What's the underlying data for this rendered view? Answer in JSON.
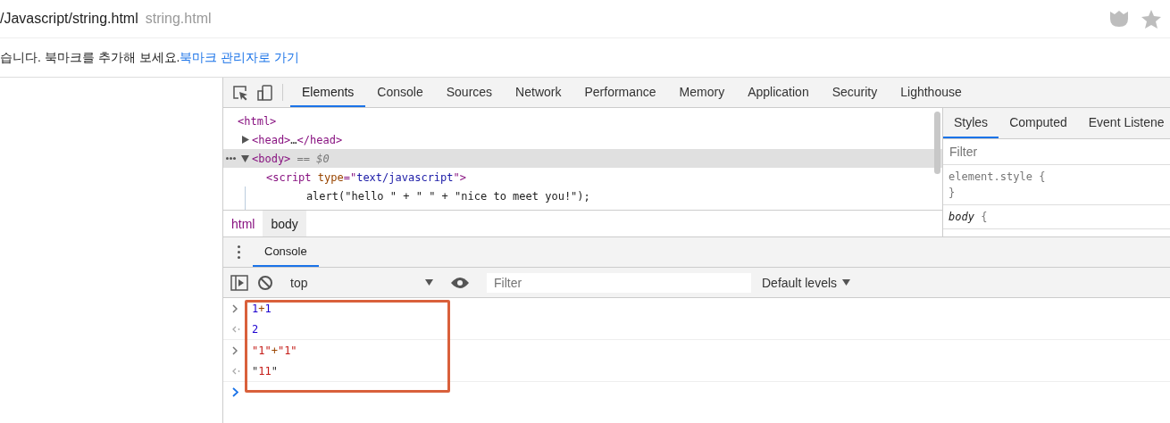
{
  "address_bar": {
    "url": "/Javascript/string.html",
    "title": "string.html"
  },
  "bookmark_bar": {
    "message": "습니다. 북마크를 추가해 보세요.",
    "link": "북마크 관리자로 가기"
  },
  "devtools": {
    "tabs": [
      {
        "label": "Elements",
        "selected": true
      },
      {
        "label": "Console",
        "selected": false
      },
      {
        "label": "Sources",
        "selected": false
      },
      {
        "label": "Network",
        "selected": false
      },
      {
        "label": "Performance",
        "selected": false
      },
      {
        "label": "Memory",
        "selected": false
      },
      {
        "label": "Application",
        "selected": false
      },
      {
        "label": "Security",
        "selected": false
      },
      {
        "label": "Lighthouse",
        "selected": false
      }
    ],
    "dom_tree": [
      {
        "selected": false,
        "tokens": [
          {
            "kind": "tag",
            "text": "<html>"
          }
        ],
        "children": [
          {
            "expanded": false,
            "selected": false,
            "tokens": [
              {
                "kind": "tag",
                "text": "<head>"
              },
              {
                "kind": "text",
                "text": "…"
              },
              {
                "kind": "tag",
                "text": "</head>"
              }
            ]
          },
          {
            "expanded": true,
            "selected": true,
            "tokens": [
              {
                "kind": "tag",
                "text": "<body>"
              },
              {
                "kind": "marker",
                "text": " == $0"
              }
            ],
            "children": [
              {
                "selected": false,
                "tokens": [
                  {
                    "kind": "tag",
                    "text": "<script "
                  },
                  {
                    "kind": "attr",
                    "text": "type"
                  },
                  {
                    "kind": "tag",
                    "text": "=\""
                  },
                  {
                    "kind": "value",
                    "text": "text/javascript"
                  },
                  {
                    "kind": "tag",
                    "text": "\">"
                  }
                ],
                "children": [
                  {
                    "selected": false,
                    "tokens": [
                      {
                        "kind": "text",
                        "text": "    alert(\"hello \" + \" \" + \"nice to meet you!\");"
                      }
                    ]
                  }
                ]
              }
            ]
          }
        ]
      }
    ],
    "breadcrumbs": [
      {
        "label": "html",
        "selected": false
      },
      {
        "label": "body",
        "selected": true
      }
    ],
    "styles": {
      "tabs": [
        {
          "label": "Styles",
          "selected": true
        },
        {
          "label": "Computed",
          "selected": false
        },
        {
          "label": "Event Listene",
          "selected": false
        }
      ],
      "filter": {
        "placeholder": "Filter"
      },
      "rules": [
        {
          "kind": "inline",
          "selector": "element.style",
          "open": " {",
          "close": "}"
        },
        {
          "kind": "tag",
          "selector": "body",
          "open": " {"
        }
      ]
    },
    "drawer": {
      "tabs": [
        {
          "label": "Console",
          "selected": true
        }
      ]
    },
    "console": {
      "context": "top",
      "filter": {
        "placeholder": "Filter"
      },
      "levels": "Default levels",
      "entries": [
        {
          "kind": "input",
          "tokens": [
            {
              "kind": "number",
              "text": "1"
            },
            {
              "kind": "operator",
              "text": "+"
            },
            {
              "kind": "number",
              "text": "1"
            }
          ]
        },
        {
          "kind": "output",
          "tokens": [
            {
              "kind": "number",
              "text": "2"
            }
          ]
        },
        {
          "kind": "input",
          "tokens": [
            {
              "kind": "string",
              "text": "\"1\""
            },
            {
              "kind": "operator",
              "text": "+"
            },
            {
              "kind": "string",
              "text": "\"1\""
            }
          ]
        },
        {
          "kind": "output",
          "tokens": [
            {
              "kind": "quote",
              "text": "\""
            },
            {
              "kind": "string",
              "text": "11"
            },
            {
              "kind": "quote",
              "text": "\""
            }
          ]
        }
      ]
    }
  }
}
